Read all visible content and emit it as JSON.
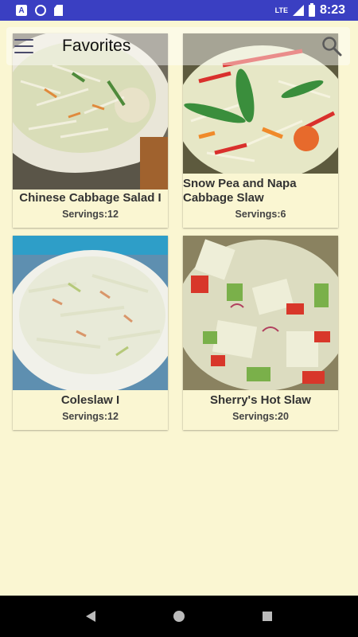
{
  "status_bar": {
    "time": "8:23",
    "network": "LTE",
    "left_icons": [
      "a-notification-icon",
      "sync-circle-icon",
      "sd-card-icon"
    ],
    "right_icons": [
      "signal-icon",
      "battery-icon"
    ]
  },
  "toolbar": {
    "title": "Favorites",
    "menu_icon": "hamburger-menu-icon",
    "search_icon": "search-icon"
  },
  "recipes": [
    {
      "title": "Chinese Cabbage Salad I",
      "servings": "Servings:12"
    },
    {
      "title": "Snow Pea and Napa Cabbage Slaw",
      "servings": "Servings:6"
    },
    {
      "title": "Coleslaw I",
      "servings": "Servings:12"
    },
    {
      "title": "Sherry's Hot Slaw",
      "servings": "Servings:20"
    }
  ],
  "nav_bar": {
    "icons": [
      "back-icon",
      "home-icon",
      "recents-icon"
    ]
  },
  "colors": {
    "status_bar": "#3a3fc2",
    "background": "#faf6d2",
    "nav_bar": "#000000"
  }
}
